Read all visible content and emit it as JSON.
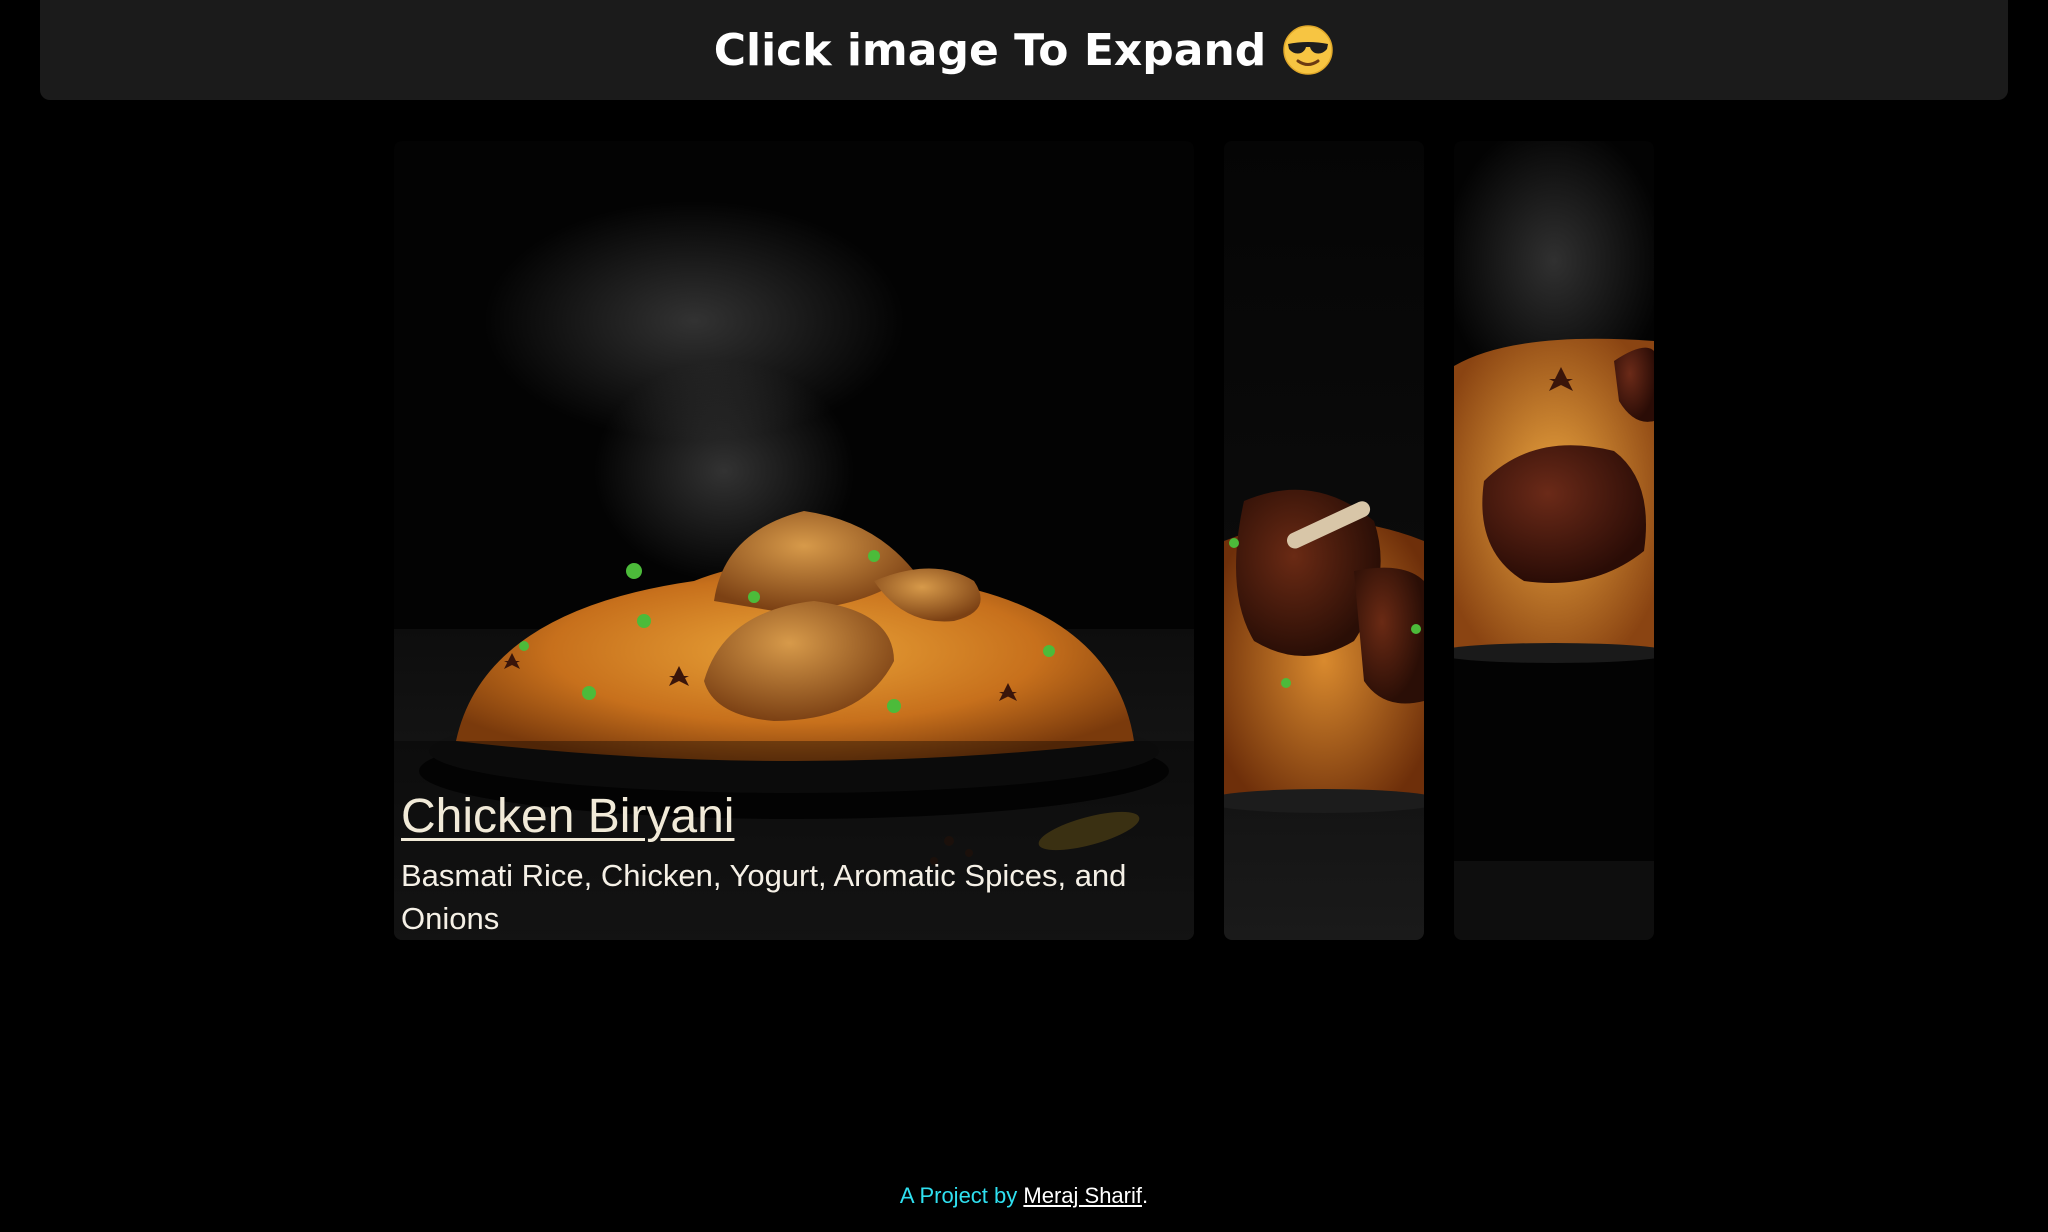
{
  "header": {
    "title": "Click image To Expand",
    "emoji_icon": "sunglasses-face-icon"
  },
  "gallery": {
    "active": {
      "title": "Chicken Biryani",
      "description": "Basmati Rice, Chicken, Yogurt, Aromatic Spices, and Onions"
    }
  },
  "footer": {
    "prefix": "A Project by",
    "author": "Meraj Sharif",
    "suffix": "."
  },
  "colors": {
    "background": "#000000",
    "header_bg": "#1b1b1b",
    "footer_accent": "#2fe0f0",
    "caption_text": "#f1ead8"
  }
}
